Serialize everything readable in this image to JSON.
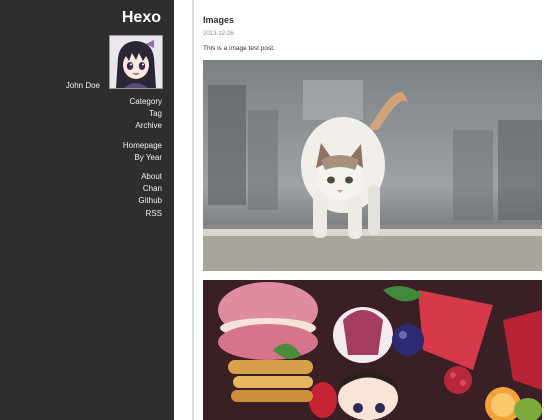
{
  "blog": {
    "title": "Hexo",
    "author": "John Doe"
  },
  "nav": {
    "group1": [
      "Category",
      "Tag",
      "Archive"
    ],
    "group2": [
      "Homepage",
      "By Year"
    ],
    "group3": [
      "About",
      "Chan",
      "Github",
      "RSS"
    ]
  },
  "post": {
    "title": "Images",
    "date": "2013-12-26",
    "text": "This is a image test post."
  },
  "colors": {
    "sidebar_bg": "#2e2e2e",
    "sidebar_text": "#f0f0f0",
    "title_text": "#333333",
    "date_text": "#8a8a8a"
  },
  "icons": [
    "avatar-anime-girl"
  ]
}
